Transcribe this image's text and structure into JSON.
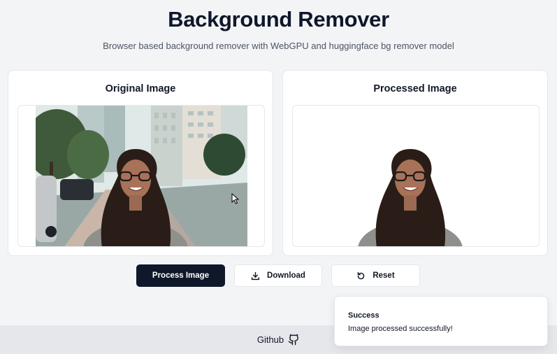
{
  "header": {
    "title": "Background Remover",
    "subtitle": "Browser based background remover with WebGPU and huggingface bg remover model"
  },
  "panels": {
    "original": {
      "title": "Original Image"
    },
    "processed": {
      "title": "Processed Image"
    }
  },
  "actions": {
    "process_label": "Process Image",
    "download_label": "Download",
    "reset_label": "Reset",
    "download_icon": "download-icon",
    "reset_icon": "reset-icon"
  },
  "footer": {
    "link_label": "Github",
    "icon": "github-icon"
  },
  "toast": {
    "title": "Success",
    "message": "Image processed successfully!"
  },
  "colors": {
    "primary_button": "#0f172a",
    "background": "#f3f4f6",
    "footer": "#e5e7eb"
  }
}
